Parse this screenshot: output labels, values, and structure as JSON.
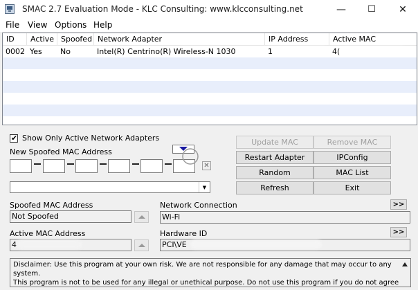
{
  "window": {
    "title": "SMAC 2.7  Evaluation Mode  -  KLC Consulting:  www.klcconsulting.net",
    "minimize": "—",
    "maximize": "☐",
    "close": "✕"
  },
  "menu": [
    "File",
    "View",
    "Options",
    "Help"
  ],
  "adapters_table": {
    "columns": [
      "ID",
      "Active",
      "Spoofed",
      "Network Adapter",
      "IP Address",
      "Active MAC"
    ],
    "rows": [
      [
        "0002",
        "Yes",
        "No",
        "Intel(R) Centrino(R) Wireless-N 1030",
        "1",
        "4("
      ]
    ]
  },
  "show_active_only": {
    "label": "Show Only Active Network Adapters",
    "checked": true
  },
  "new_mac": {
    "label": "New Spoofed MAC Address",
    "segments": [
      "",
      "",
      "",
      "",
      "",
      ""
    ],
    "clear": "✕"
  },
  "vendor_combo": {
    "value": ""
  },
  "buttons": {
    "update_mac": "Update MAC",
    "remove_mac": "Remove MAC",
    "restart_adapter": "Restart Adapter",
    "ipconfig": "IPConfig",
    "random": "Random",
    "mac_list": "MAC List",
    "refresh": "Refresh",
    "exit": "Exit"
  },
  "spoofed_mac": {
    "label": "Spoofed MAC Address",
    "value": "Not Spoofed"
  },
  "active_mac": {
    "label": "Active MAC Address",
    "value": "4"
  },
  "network_connection": {
    "label": "Network Connection",
    "value": "Wi-Fi",
    "more": ">>"
  },
  "hardware_id": {
    "label": "Hardware ID",
    "value": "PCI\\VE",
    "more": ">>"
  },
  "disclaimer": {
    "line1": "Disclaimer: Use this program at your own risk.  We are not responsible for any damage that may occur to any system.",
    "line2": "This program is not to be used for any illegal or unethical purpose.  Do not use this program if you do not agree with"
  },
  "colors": {
    "accent": "#1a1aa0",
    "titlebar": "#ffffff",
    "window_bg": "#f0f0f0",
    "grid_stripe": "#e8eefb"
  }
}
